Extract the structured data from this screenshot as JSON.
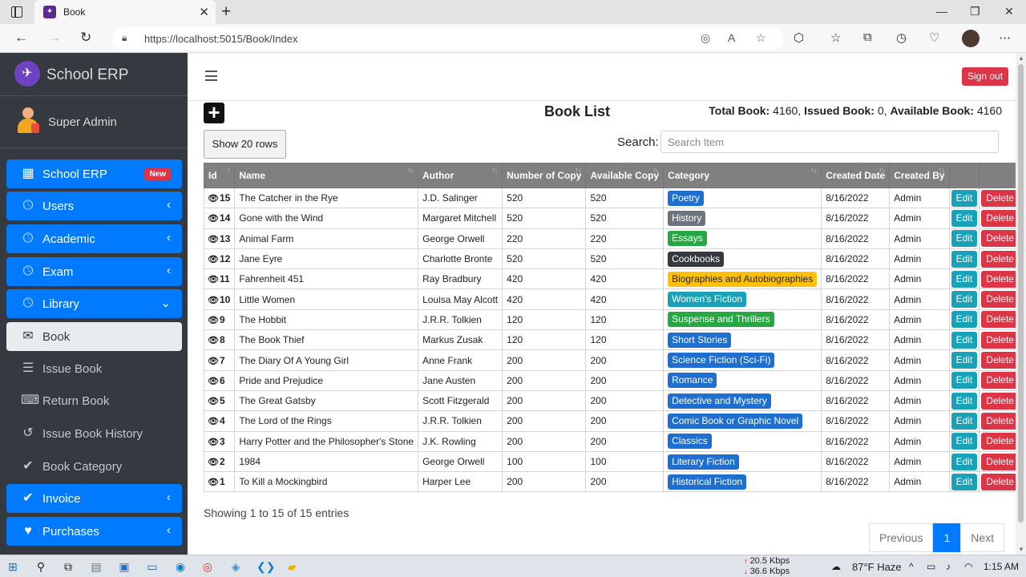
{
  "browser": {
    "tab_title": "Book",
    "url": "https://localhost:5015/Book/Index"
  },
  "sidebar": {
    "brand": "School ERP",
    "user": "Super Admin",
    "new_badge": "New",
    "items": [
      {
        "label": "School ERP",
        "icon": "grid-icon"
      },
      {
        "label": "Users",
        "icon": "clock-icon"
      },
      {
        "label": "Academic",
        "icon": "clock-icon"
      },
      {
        "label": "Exam",
        "icon": "clock-icon"
      },
      {
        "label": "Library",
        "icon": "clock-icon"
      },
      {
        "label": "Book",
        "icon": "envelope-icon"
      },
      {
        "label": "Issue Book",
        "icon": "database-icon"
      },
      {
        "label": "Return Book",
        "icon": "keyboard-icon"
      },
      {
        "label": "Issue Book History",
        "icon": "history-icon"
      },
      {
        "label": "Book Category",
        "icon": "check-circle-icon"
      },
      {
        "label": "Invoice",
        "icon": "check-circle-icon"
      },
      {
        "label": "Purchases",
        "icon": "heart-icon"
      }
    ]
  },
  "topnav": {
    "signout": "Sign out"
  },
  "main": {
    "title": "Book List",
    "totals": {
      "total_label": "Total Book:",
      "total_value": "4160",
      "issued_label": "Issued Book:",
      "issued_value": "0",
      "available_label": "Available Book:",
      "available_value": "4160"
    },
    "show_rows": "Show 20 rows",
    "search_label": "Search:",
    "search_placeholder": "Search Item",
    "columns": [
      "Id",
      "Name",
      "Author",
      "Number of Copy",
      "Available Copy",
      "Category",
      "Created Date",
      "Created By",
      "",
      ""
    ],
    "edit_label": "Edit",
    "delete_label": "Delete",
    "rows": [
      {
        "id": "15",
        "name": "The Catcher in the Rye",
        "author": "J.D. Salinger",
        "copies": "520",
        "available": "520",
        "category": "Poetry",
        "cat_color": "#1e6fd0",
        "date": "8/16/2022",
        "by": "Admin"
      },
      {
        "id": "14",
        "name": "Gone with the Wind",
        "author": "Margaret Mitchell",
        "copies": "520",
        "available": "520",
        "category": "History",
        "cat_color": "#6c757d",
        "date": "8/16/2022",
        "by": "Admin"
      },
      {
        "id": "13",
        "name": "Animal Farm",
        "author": "George Orwell",
        "copies": "220",
        "available": "220",
        "category": "Essays",
        "cat_color": "#28a745",
        "date": "8/16/2022",
        "by": "Admin"
      },
      {
        "id": "12",
        "name": "Jane Eyre",
        "author": "Charlotte Bronte",
        "copies": "520",
        "available": "520",
        "category": "Cookbooks",
        "cat_color": "#343a40",
        "date": "8/16/2022",
        "by": "Admin"
      },
      {
        "id": "11",
        "name": "Fahrenheit 451",
        "author": "Ray Bradbury",
        "copies": "420",
        "available": "420",
        "category": "Biographies and Autobiographies",
        "cat_color": "#ffc107",
        "date": "8/16/2022",
        "by": "Admin"
      },
      {
        "id": "10",
        "name": "Little Women",
        "author": "Louisa May Alcott",
        "copies": "420",
        "available": "420",
        "category": "Women's Fiction",
        "cat_color": "#17a2b8",
        "date": "8/16/2022",
        "by": "Admin"
      },
      {
        "id": "9",
        "name": "The Hobbit",
        "author": "J.R.R. Tolkien",
        "copies": "120",
        "available": "120",
        "category": "Suspense and Thrillers",
        "cat_color": "#28a745",
        "date": "8/16/2022",
        "by": "Admin"
      },
      {
        "id": "8",
        "name": "The Book Thief",
        "author": "Markus Zusak",
        "copies": "120",
        "available": "120",
        "category": "Short Stories",
        "cat_color": "#1e6fd0",
        "date": "8/16/2022",
        "by": "Admin"
      },
      {
        "id": "7",
        "name": "The Diary Of A Young Girl",
        "author": "Anne Frank",
        "copies": "200",
        "available": "200",
        "category": "Science Fiction (Sci-Fi)",
        "cat_color": "#1e6fd0",
        "date": "8/16/2022",
        "by": "Admin"
      },
      {
        "id": "6",
        "name": "Pride and Prejudice",
        "author": "Jane Austen",
        "copies": "200",
        "available": "200",
        "category": "Romance",
        "cat_color": "#1e6fd0",
        "date": "8/16/2022",
        "by": "Admin"
      },
      {
        "id": "5",
        "name": "The Great Gatsby",
        "author": "Scott Fitzgerald",
        "copies": "200",
        "available": "200",
        "category": "Detective and Mystery",
        "cat_color": "#1e6fd0",
        "date": "8/16/2022",
        "by": "Admin"
      },
      {
        "id": "4",
        "name": "The Lord of the Rings",
        "author": "J.R.R. Tolkien",
        "copies": "200",
        "available": "200",
        "category": "Comic Book or Graphic Novel",
        "cat_color": "#1e6fd0",
        "date": "8/16/2022",
        "by": "Admin"
      },
      {
        "id": "3",
        "name": "Harry Potter and the Philosopher's Stone",
        "author": "J.K. Rowling",
        "copies": "200",
        "available": "200",
        "category": "Classics",
        "cat_color": "#1e6fd0",
        "date": "8/16/2022",
        "by": "Admin"
      },
      {
        "id": "2",
        "name": "1984",
        "author": "George Orwell",
        "copies": "100",
        "available": "100",
        "category": "Literary Fiction",
        "cat_color": "#1e6fd0",
        "date": "8/16/2022",
        "by": "Admin"
      },
      {
        "id": "1",
        "name": "To Kill a Mockingbird",
        "author": "Harper Lee",
        "copies": "200",
        "available": "200",
        "category": "Historical Fiction",
        "cat_color": "#1e6fd0",
        "date": "8/16/2022",
        "by": "Admin"
      }
    ],
    "entries_text": "Showing 1 to 15 of 15 entries",
    "pagination": {
      "previous": "Previous",
      "current": "1",
      "next": "Next"
    }
  },
  "taskbar": {
    "net_up": "20.5 Kbps",
    "net_down": "36.6 Kbps",
    "weather": "87°F  Haze",
    "time": "1:15 AM"
  }
}
